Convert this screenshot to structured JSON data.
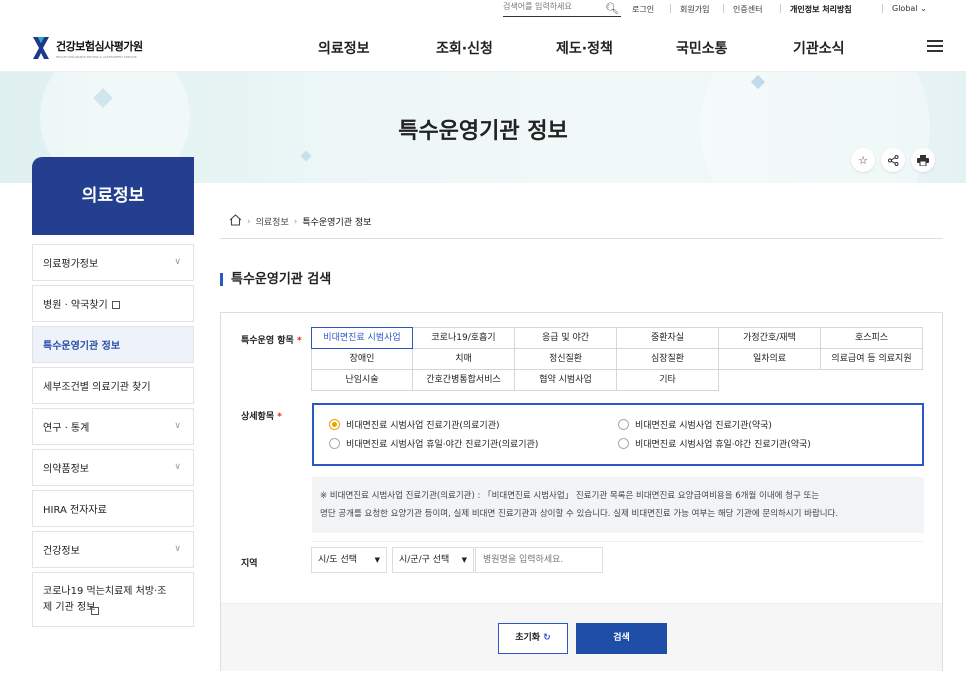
{
  "topbar": {
    "search_placeholder": "검색어를 입력하세요",
    "links": [
      "로그인",
      "회원가입",
      "인증센터",
      "개인정보 처리방침",
      "Global"
    ]
  },
  "header": {
    "logo_kr": "건강보험심사평가원",
    "logo_en": "HEALTH INSURANCE REVIEW & ASSESSMENT SERVICE",
    "nav": [
      "의료정보",
      "조회·신청",
      "제도·정책",
      "국민소통",
      "기관소식"
    ]
  },
  "banner": {
    "title": "특수운영기관 정보"
  },
  "sidebar": {
    "title": "의료정보",
    "items": [
      {
        "label": "의료평가정보"
      },
      {
        "label": "병원 · 약국찾기"
      },
      {
        "label": "특수운영기관 정보"
      },
      {
        "label": "세부조건별 의료기관 찾기"
      },
      {
        "label": "연구 · 통계"
      },
      {
        "label": "의약품정보"
      },
      {
        "label": "HIRA 전자자료"
      },
      {
        "label": "건강정보"
      },
      {
        "label": "코로나19 먹는치료제 처방·조제 기관 정보"
      }
    ]
  },
  "breadcrumb": [
    "의료정보",
    "특수운영기관 정보"
  ],
  "section": {
    "title": "특수운영기관 검색"
  },
  "form": {
    "category_label": "특수운영 항목",
    "categories": [
      "비대면진료 시범사업",
      "코로나19/호흡기",
      "응급 및 야간",
      "중환자실",
      "가정간호/재택",
      "호스피스",
      "장애인",
      "치매",
      "정신질환",
      "심장질환",
      "일차의료",
      "의료급여 등 의료지원",
      "난임시술",
      "간호간병통합서비스",
      "협약 시범사업",
      "기타"
    ],
    "selected_category": "비대면진료 시범사업",
    "detail_label": "상세항목",
    "details": [
      "비대면진료 시범사업 진료기관(의료기관)",
      "비대면진료 시범사업 진료기관(약국)",
      "비대면진료 시범사업 휴일·야간 진료기관(의료기관)",
      "비대면진료 시범사업 휴일·야간 진료기관(약국)"
    ],
    "selected_detail": "비대면진료 시범사업 진료기관(의료기관)",
    "notice_line1": "※ 비대면진료 시범사업 진료기관(의료기관) : 「비대면진료 시범사업」 진료기관 목록은 비대면진료 요양급여비용을 6개월 이내에 청구 또는",
    "notice_line2": "명단 공개를 요청한 요양기관 등이며, 실제 비대면 진료기관과 상이할 수 있습니다. 실제 비대면진료 가능 여부는 해당 기관에 문의하시기 바랍니다.",
    "region_label": "지역",
    "sido_select": "시/도 선택",
    "sigungu_select": "시/군/구 선택",
    "hospital_placeholder": "병원명을 입력하세요.",
    "reset_label": "초기화",
    "search_label": "검색"
  },
  "colors": {
    "primary": "#243f8f",
    "accent": "#2b57c7",
    "radio_on": "#f0a000"
  }
}
